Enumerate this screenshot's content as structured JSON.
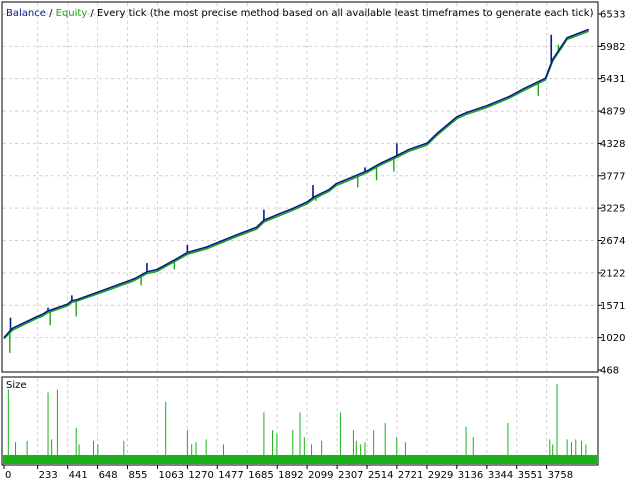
{
  "header": {
    "balance_label": "Balance",
    "separator": " / ",
    "equity_label": "Equity",
    "description": " / Every tick (the most precise method based on all available least timeframes to generate each tick)"
  },
  "colors": {
    "balance": "#0b1a8c",
    "equity": "#1ea51e",
    "size_bars": "#19b019",
    "grid": "#d0d0d0",
    "frame": "#000000"
  },
  "chart_data": [
    {
      "type": "line",
      "title": "",
      "legend": [
        "Balance",
        "Equity"
      ],
      "grid": true,
      "y_axis_position": "right",
      "xlim": [
        0,
        4100
      ],
      "ylim": [
        468,
        6533
      ],
      "x_ticks": [
        0,
        233,
        441,
        648,
        855,
        1063,
        1270,
        1477,
        1685,
        1892,
        2099,
        2307,
        2514,
        2721,
        2929,
        3136,
        3344,
        3551,
        3758
      ],
      "y_ticks": [
        468,
        1020,
        1571,
        2122,
        2674,
        3225,
        3777,
        4328,
        4879,
        5431,
        5982,
        6533
      ],
      "series": [
        {
          "name": "Balance",
          "x": [
            0,
            40,
            60,
            230,
            270,
            300,
            440,
            470,
            500,
            700,
            900,
            990,
            1060,
            1200,
            1270,
            1400,
            1600,
            1750,
            1800,
            1900,
            2000,
            2099,
            2150,
            2250,
            2300,
            2400,
            2514,
            2600,
            2721,
            2800,
            2929,
            3000,
            3136,
            3200,
            3344,
            3500,
            3600,
            3700,
            3750,
            3800,
            3900,
            4050
          ],
          "y": [
            1020,
            1130,
            1180,
            1380,
            1420,
            1470,
            1590,
            1650,
            1660,
            1840,
            2020,
            2140,
            2180,
            2370,
            2470,
            2560,
            2760,
            2900,
            3020,
            3120,
            3220,
            3330,
            3420,
            3540,
            3640,
            3740,
            3860,
            3980,
            4120,
            4220,
            4330,
            4500,
            4780,
            4850,
            4970,
            5130,
            5260,
            5380,
            5440,
            5760,
            6130,
            6270
          ]
        },
        {
          "name": "Equity",
          "x": [
            0,
            40,
            60,
            230,
            270,
            300,
            440,
            470,
            500,
            700,
            900,
            990,
            1060,
            1200,
            1270,
            1400,
            1600,
            1750,
            1800,
            1900,
            2000,
            2099,
            2150,
            2250,
            2300,
            2400,
            2514,
            2600,
            2721,
            2800,
            2929,
            3000,
            3136,
            3200,
            3344,
            3500,
            3600,
            3700,
            3750,
            3800,
            3900,
            4050
          ],
          "y": [
            1000,
            1100,
            1150,
            1350,
            1390,
            1440,
            1560,
            1620,
            1640,
            1810,
            1990,
            2110,
            2150,
            2340,
            2440,
            2530,
            2730,
            2870,
            2990,
            3090,
            3190,
            3300,
            3390,
            3510,
            3610,
            3710,
            3830,
            3950,
            4090,
            4190,
            4300,
            4470,
            4750,
            4820,
            4940,
            5100,
            5230,
            5350,
            5410,
            5730,
            6100,
            6240
          ]
        }
      ],
      "balance_spikes": [
        [
          45,
          1360
        ],
        [
          305,
          1530
        ],
        [
          470,
          1740
        ],
        [
          990,
          2290
        ],
        [
          1270,
          2600
        ],
        [
          1800,
          3200
        ],
        [
          2140,
          3620
        ],
        [
          2500,
          3920
        ],
        [
          2721,
          4330
        ],
        [
          3790,
          6180
        ]
      ],
      "equity_dips": [
        [
          40,
          760
        ],
        [
          320,
          1230
        ],
        [
          500,
          1380
        ],
        [
          950,
          1910
        ],
        [
          1180,
          2180
        ],
        [
          2160,
          3350
        ],
        [
          2450,
          3580
        ],
        [
          2580,
          3700
        ],
        [
          2700,
          3850
        ],
        [
          3700,
          5140
        ],
        [
          3840,
          6010
        ]
      ]
    },
    {
      "type": "bar",
      "title": "Size",
      "series_name": "Size",
      "ylim": [
        0,
        1
      ],
      "x": [
        30,
        80,
        160,
        305,
        330,
        370,
        500,
        520,
        620,
        650,
        830,
        1120,
        1270,
        1300,
        1330,
        1400,
        1520,
        1800,
        1860,
        1890,
        2000,
        2050,
        2080,
        2130,
        2200,
        2330,
        2420,
        2440,
        2470,
        2500,
        2560,
        2640,
        2720,
        2780,
        3200,
        3250,
        3490,
        3780,
        3800,
        3830,
        3900,
        3930,
        3960,
        4000,
        4030
      ],
      "values": [
        0.92,
        0.18,
        0.2,
        0.88,
        0.22,
        0.92,
        0.38,
        0.15,
        0.2,
        0.15,
        0.2,
        0.75,
        0.35,
        0.15,
        0.18,
        0.22,
        0.15,
        0.6,
        0.35,
        0.3,
        0.35,
        0.6,
        0.25,
        0.15,
        0.2,
        0.6,
        0.35,
        0.2,
        0.15,
        0.18,
        0.35,
        0.45,
        0.25,
        0.18,
        0.4,
        0.25,
        0.45,
        0.22,
        0.15,
        1.0,
        0.22,
        0.18,
        0.22,
        0.2,
        0.15
      ]
    }
  ]
}
